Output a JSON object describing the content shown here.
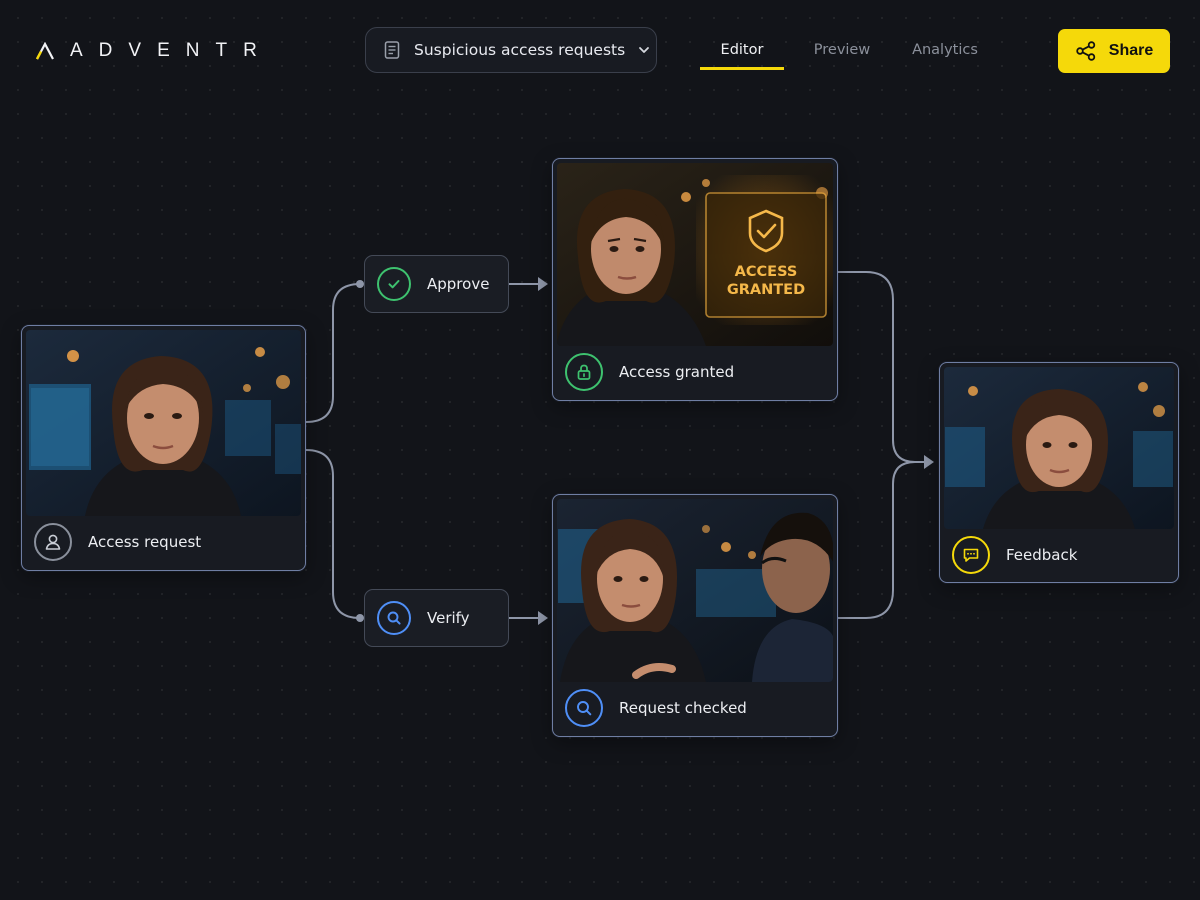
{
  "app": {
    "brand": "ADVENTR"
  },
  "header": {
    "flow_title": "Suspicious access requests",
    "tabs": [
      {
        "label": "Editor",
        "active": true
      },
      {
        "label": "Preview",
        "active": false
      },
      {
        "label": "Analytics",
        "active": false
      }
    ],
    "share_label": "Share"
  },
  "nodes": {
    "access_request": {
      "label": "Access request",
      "icon": "user-icon"
    },
    "access_granted": {
      "label": "Access granted",
      "icon": "lock-icon",
      "screen_text_1": "ACCESS",
      "screen_text_2": "GRANTED"
    },
    "request_checked": {
      "label": "Request checked",
      "icon": "search-icon"
    },
    "feedback": {
      "label": "Feedback",
      "icon": "chat-bubble-icon"
    }
  },
  "choices": {
    "approve": {
      "label": "Approve",
      "icon": "check-circle-icon"
    },
    "verify": {
      "label": "Verify",
      "icon": "search-icon"
    }
  },
  "colors": {
    "accent": "#f5d90a",
    "approve_green": "#3ec26f",
    "verify_blue": "#4f8ff7",
    "feedback_yellow": "#f5d90a",
    "node_border": "#6f7ea3",
    "connector": "#8e96a8"
  }
}
